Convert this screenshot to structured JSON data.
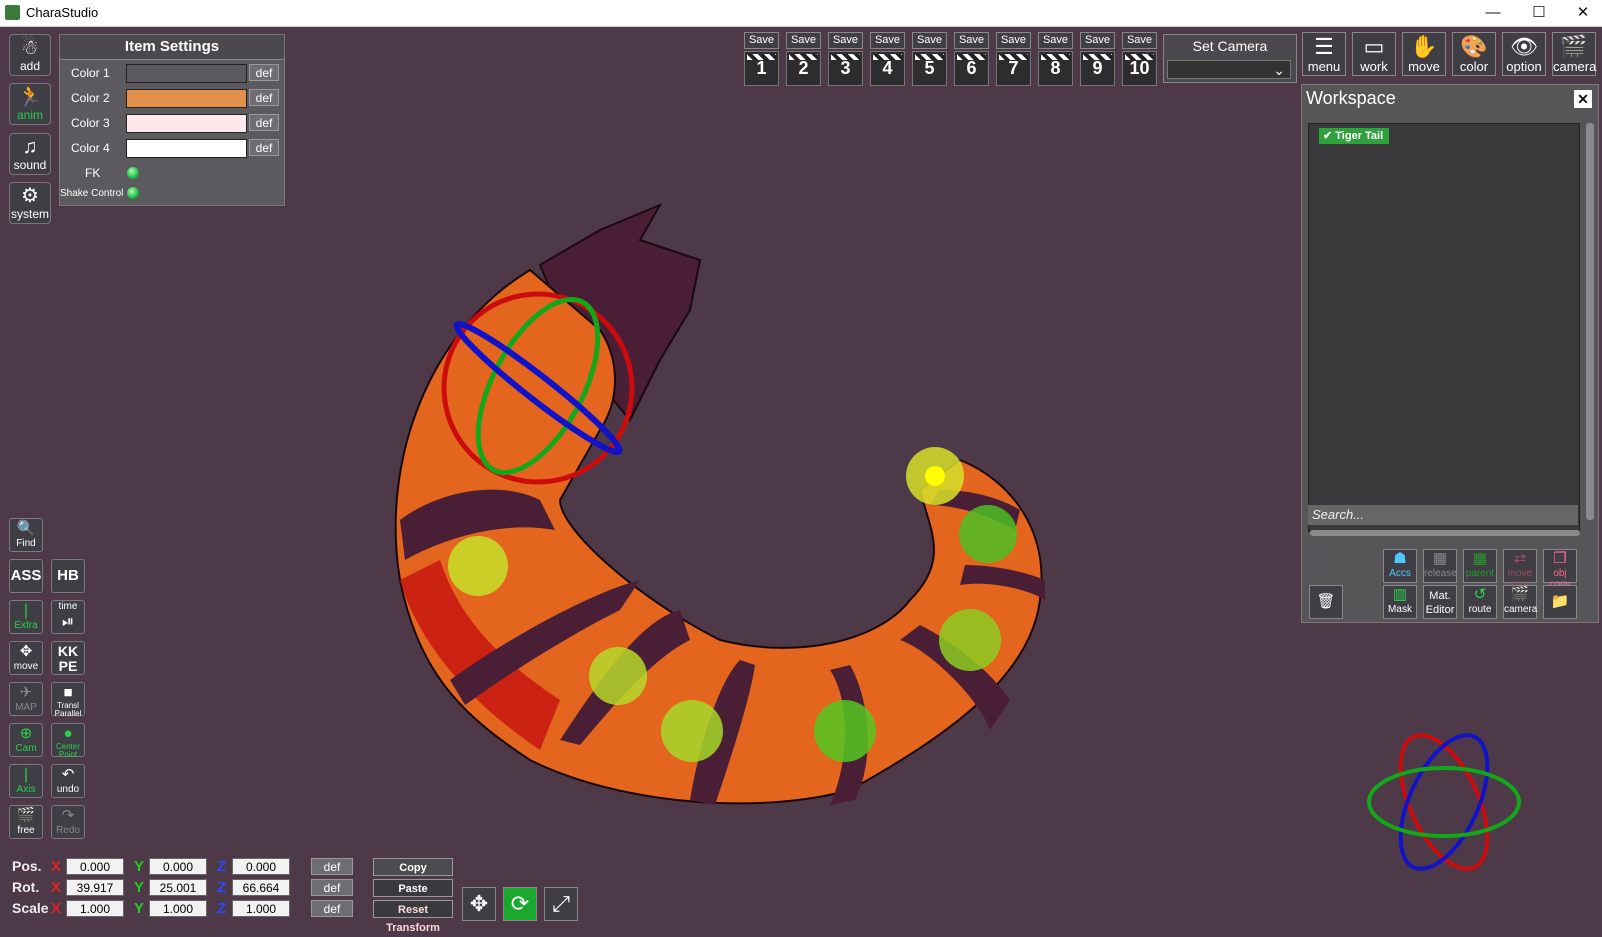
{
  "window": {
    "title": "CharaStudio",
    "minimize": "—",
    "maximize": "☐",
    "close": "✕"
  },
  "left_toolbar": [
    {
      "label": "add",
      "icon": "add-character-icon",
      "glyph": "☃"
    },
    {
      "label": "anim",
      "icon": "running-figure-icon",
      "glyph": "🏃"
    },
    {
      "label": "sound",
      "icon": "music-note-icon",
      "glyph": "♫"
    },
    {
      "label": "system",
      "icon": "gears-icon",
      "glyph": "⚙"
    }
  ],
  "item_settings": {
    "title": "Item Settings",
    "colors": [
      {
        "label": "Color 1",
        "color": "#5a5a5e",
        "def": "def"
      },
      {
        "label": "Color 2",
        "color": "#e3914a",
        "def": "def"
      },
      {
        "label": "Color 3",
        "color": "#fde8ec",
        "def": "def"
      },
      {
        "label": "Color 4",
        "color": "#ffffff",
        "def": "def"
      }
    ],
    "fk_label": "FK",
    "shake_label": "Shake Control"
  },
  "save_slots": {
    "label": "Save",
    "slots": [
      "1",
      "2",
      "3",
      "4",
      "5",
      "6",
      "7",
      "8",
      "9",
      "10"
    ]
  },
  "set_camera": {
    "title": "Set Camera",
    "value": "",
    "arrow": "⌄"
  },
  "top_icons": [
    {
      "label": "menu",
      "icon": "menu-list-icon",
      "glyph": "☰"
    },
    {
      "label": "work",
      "icon": "workspace-window-icon",
      "glyph": "▭"
    },
    {
      "label": "move",
      "icon": "hand-icon",
      "glyph": "✋"
    },
    {
      "label": "color",
      "icon": "palette-icon",
      "glyph": "🎨"
    },
    {
      "label": "option",
      "icon": "eye-icon",
      "glyph": "👁"
    },
    {
      "label": "camera",
      "icon": "clapper-icon",
      "glyph": "🎬"
    }
  ],
  "workspace": {
    "title": "Workspace",
    "close": "✕",
    "items": [
      {
        "label": "Tiger Tail",
        "check": "✔"
      }
    ],
    "search_placeholder": "Search...",
    "buttons_row1": [
      {
        "label": "Accs",
        "icon": "accessory-icon",
        "glyph": "☗"
      },
      {
        "label": "release",
        "icon": "release-icon",
        "glyph": "▦"
      },
      {
        "label": "parent",
        "icon": "parent-icon",
        "glyph": "▦"
      },
      {
        "label": "move copy",
        "icon": "move-copy-icon",
        "glyph": "⇄"
      },
      {
        "label": "obj copy",
        "icon": "object-copy-icon",
        "glyph": "❐"
      }
    ],
    "buttons_row2": [
      {
        "label": "",
        "icon": "trash-icon",
        "glyph": "🗑"
      },
      {
        "label": "Mask",
        "icon": "mask-icon",
        "glyph": "▥"
      },
      {
        "label": "Mat. Editor",
        "icon": "material-editor-icon",
        "glyph": ""
      },
      {
        "label": "route",
        "icon": "route-icon",
        "glyph": "↺"
      },
      {
        "label": "camera",
        "icon": "camera-icon",
        "glyph": "🎬"
      },
      {
        "label": "",
        "icon": "folder-icon",
        "glyph": "📁"
      }
    ]
  },
  "left_tools": [
    {
      "label": "Find",
      "icon": "magnifier-icon",
      "glyph": "🔍"
    },
    {
      "label": "ASS",
      "icon": "",
      "glyph": ""
    },
    {
      "label": "HB",
      "icon": "",
      "glyph": ""
    },
    {
      "label": "Extra",
      "icon": "extra-icon",
      "glyph": "❘"
    },
    {
      "label": "time",
      "icon": "play-pause-icon",
      "glyph": "⏯"
    },
    {
      "label": "move",
      "icon": "move-arrows-icon",
      "glyph": "✥"
    },
    {
      "label": "KK PE",
      "icon": "",
      "glyph": ""
    },
    {
      "label": "MAP",
      "icon": "map-icon",
      "glyph": "✈"
    },
    {
      "label": "Transl Parallel",
      "icon": "translate-parallel-icon",
      "glyph": "■"
    },
    {
      "label": "Cam",
      "icon": "camera-plus-icon",
      "glyph": "⊕"
    },
    {
      "label": "Center Point",
      "icon": "center-point-icon",
      "glyph": "●"
    },
    {
      "label": "Axis",
      "icon": "axis-icon",
      "glyph": "❘"
    },
    {
      "label": "undo",
      "icon": "undo-arrow-icon",
      "glyph": "↶"
    },
    {
      "label": "free",
      "icon": "free-camera-icon",
      "glyph": "🎬"
    },
    {
      "label": "Redo",
      "icon": "redo-arrow-icon",
      "glyph": "↷"
    }
  ],
  "transform": {
    "rows": [
      {
        "label": "Pos.",
        "x": "0.000",
        "y": "0.000",
        "z": "0.000",
        "def": "def"
      },
      {
        "label": "Rot.",
        "x": "39.917",
        "y": "25.001",
        "z": "66.664",
        "def": "def"
      },
      {
        "label": "Scale",
        "x": "1.000",
        "y": "1.000",
        "z": "1.000",
        "def": "def"
      }
    ],
    "axis_x": "X",
    "axis_y": "Y",
    "axis_z": "Z",
    "copy": "Copy Transform",
    "paste": "Paste Transform",
    "reset": "Reset Transform"
  },
  "colors": {
    "background": "#4d3947",
    "accent_green": "#29d14a",
    "ring_red": "#cc0c0c",
    "ring_green": "#12a81a",
    "ring_blue": "#1212c8"
  }
}
